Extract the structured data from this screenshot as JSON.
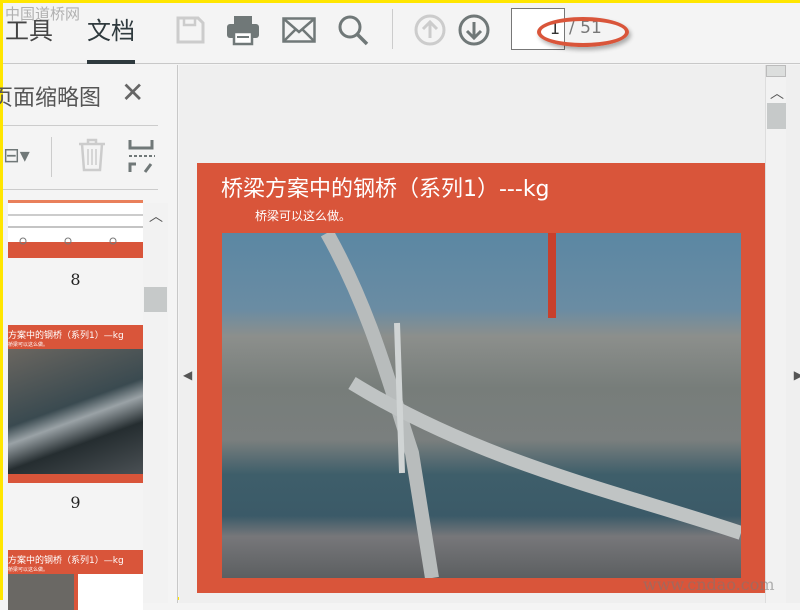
{
  "watermark_top": "中国道桥网",
  "watermark_bottom": "www.cndao.com",
  "toolbar": {
    "tabs": [
      {
        "label": "工具"
      },
      {
        "label": "文档"
      }
    ],
    "page_current": "1",
    "page_total": "/ 51"
  },
  "panel": {
    "title": "页面缩略图",
    "thumbnails": [
      {
        "number": "8"
      },
      {
        "number": "9",
        "title": "方案中的钢桥（系列1）—kg",
        "subtitle": "桥梁可以这么做。"
      },
      {
        "title": "方案中的钢桥（系列1）—kg",
        "subtitle": "桥梁可以这么做。"
      }
    ]
  },
  "slide": {
    "title": "桥梁方案中的钢桥（系列1）---kg",
    "subtitle": "桥梁可以这么做。"
  },
  "colors": {
    "accent": "#d9553a",
    "highlight": "#ffe600"
  }
}
